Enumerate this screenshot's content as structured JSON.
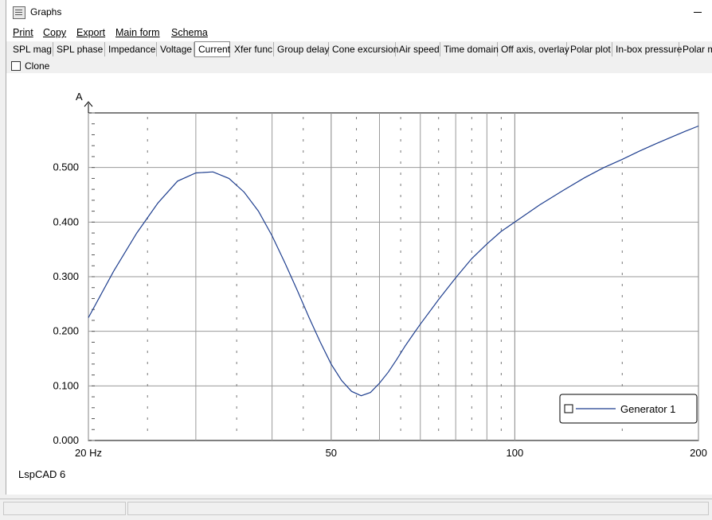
{
  "window": {
    "title": "Graphs"
  },
  "menu": [
    "Print",
    "Copy",
    "Export",
    "Main form",
    "Schema"
  ],
  "tabs": [
    {
      "label": "SPL mag",
      "active": false
    },
    {
      "label": "SPL phase",
      "active": false
    },
    {
      "label": "Impedance",
      "active": false
    },
    {
      "label": "Voltage",
      "active": false
    },
    {
      "label": "Current",
      "active": true
    },
    {
      "label": "Xfer func",
      "active": false
    },
    {
      "label": "Group delay",
      "active": false
    },
    {
      "label": "Cone excursion",
      "active": false
    },
    {
      "label": "Air speed",
      "active": false
    },
    {
      "label": "Time domain",
      "active": false
    },
    {
      "label": "Off axis, overlay",
      "active": false
    },
    {
      "label": "Polar plot",
      "active": false
    },
    {
      "label": "In-box pressure",
      "active": false
    },
    {
      "label": "Polar m",
      "active": false
    }
  ],
  "clone": {
    "label": "Clone",
    "checked": false
  },
  "brand": "LspCAD 6",
  "colors": {
    "curve": "#1f3f8f",
    "grid": "#9a9a9a",
    "axis": "#000000"
  },
  "chart_data": {
    "type": "line",
    "ylabel": "A",
    "xscale": "log",
    "xlim": [
      20,
      200
    ],
    "ylim": [
      0,
      0.6
    ],
    "grid": true,
    "x_ticks": [
      20,
      50,
      100,
      200
    ],
    "x_tick_labels": [
      "20 Hz",
      "50",
      "100",
      "200"
    ],
    "y_ticks": [
      0,
      0.1,
      0.2,
      0.3,
      0.4,
      0.5
    ],
    "y_tick_labels": [
      "0.000",
      "0.100",
      "0.200",
      "0.300",
      "0.400",
      "0.500"
    ],
    "legend_position": "bottom-right",
    "series": [
      {
        "name": "Generator 1",
        "x": [
          20,
          22,
          24,
          26,
          28,
          30,
          32,
          34,
          36,
          38,
          40,
          42,
          44,
          46,
          48,
          50,
          52,
          54,
          56,
          58,
          60,
          62,
          64,
          66,
          68,
          70,
          75,
          80,
          85,
          90,
          95,
          100,
          110,
          120,
          130,
          140,
          150,
          160,
          170,
          180,
          190,
          200
        ],
        "y": [
          0.225,
          0.31,
          0.38,
          0.435,
          0.475,
          0.49,
          0.492,
          0.48,
          0.455,
          0.42,
          0.375,
          0.325,
          0.275,
          0.225,
          0.18,
          0.14,
          0.11,
          0.09,
          0.082,
          0.088,
          0.105,
          0.125,
          0.148,
          0.172,
          0.193,
          0.213,
          0.258,
          0.298,
          0.333,
          0.36,
          0.383,
          0.4,
          0.432,
          0.458,
          0.481,
          0.5,
          0.515,
          0.53,
          0.543,
          0.555,
          0.566,
          0.576
        ]
      }
    ]
  }
}
